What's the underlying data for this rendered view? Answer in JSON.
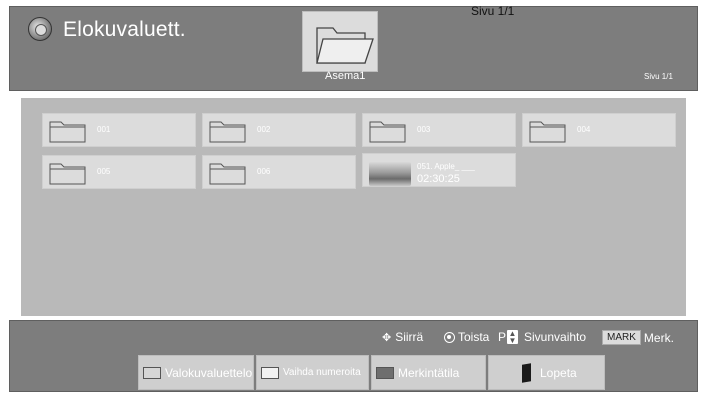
{
  "header": {
    "title": "Elokuvaluett.",
    "page_indicator_top": "Sivu 1/1",
    "drive_label": "Asema1",
    "page_indicator": "Sivu 1/1"
  },
  "items": [
    {
      "label": "001",
      "type": "folder"
    },
    {
      "label": "002",
      "type": "folder"
    },
    {
      "label": "003",
      "type": "folder"
    },
    {
      "label": "004",
      "type": "folder"
    },
    {
      "label": "005",
      "type": "folder"
    },
    {
      "label": "006",
      "type": "folder"
    },
    {
      "label": "051. Apple_ ___",
      "duration": "02:30:25",
      "type": "video"
    }
  ],
  "hints": {
    "move": "Siirrä",
    "play": "Toista",
    "page_prefix": "P",
    "page_change": "Sivunvaihto",
    "mark_key": "MARK",
    "mark": "Merk."
  },
  "buttons": {
    "photo_list": "Valokuvaluettelo",
    "change_numbers": "Vaihda numeroita",
    "mark_mode": "Merkintätila",
    "quit": "Lopeta"
  },
  "colors": {
    "header_bg": "#7d7d7d",
    "content_bg": "#b9b9b9",
    "tile_bg": "#dcdcdc"
  }
}
